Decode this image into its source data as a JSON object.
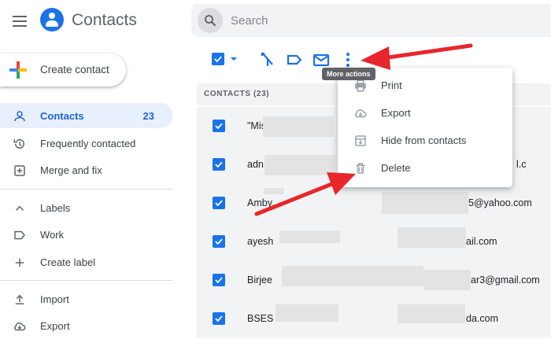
{
  "app": {
    "title": "Contacts"
  },
  "search": {
    "placeholder": "Search"
  },
  "create": {
    "label": "Create contact"
  },
  "sidebar": {
    "items": [
      {
        "label": "Contacts",
        "count": "23",
        "active": true,
        "icon": "person-icon"
      },
      {
        "label": "Frequently contacted",
        "icon": "history-icon"
      },
      {
        "label": "Merge and fix",
        "icon": "merge-icon"
      }
    ],
    "labels": {
      "header": "Labels",
      "items": [
        {
          "label": "Work",
          "icon": "label-icon"
        },
        {
          "label": "Create label",
          "icon": "plus-icon"
        }
      ]
    },
    "bottom": [
      {
        "label": "Import",
        "icon": "upload-icon"
      },
      {
        "label": "Export",
        "icon": "cloud-download-icon"
      }
    ]
  },
  "toolbar": {
    "tooltip": "More actions",
    "icons": [
      "select-all-checkbox",
      "chevron-down-icon",
      "merge-icon",
      "label-icon",
      "email-icon",
      "more-vert-icon"
    ]
  },
  "list": {
    "heading": "CONTACTS (23)",
    "rows": [
      {
        "name": "\"Mis",
        "email": ""
      },
      {
        "name": "adn",
        "email": "l.c"
      },
      {
        "name": "Amby...",
        "email": "5@yahoo.com"
      },
      {
        "name": "ayesh",
        "email": "ail.com"
      },
      {
        "name": "Birjee",
        "email": "ar3@gmail.com"
      },
      {
        "name": "BSES",
        "email": "da.com"
      }
    ]
  },
  "menu": {
    "items": [
      {
        "label": "Print",
        "icon": "print-icon"
      },
      {
        "label": "Export",
        "icon": "cloud-download-icon"
      },
      {
        "label": "Hide from contacts",
        "icon": "archive-icon"
      },
      {
        "label": "Delete",
        "icon": "trash-icon"
      }
    ]
  },
  "colors": {
    "accent": "#1a73e8",
    "annotation_arrow": "#e8262b",
    "active_bg": "#e8f0fe"
  }
}
